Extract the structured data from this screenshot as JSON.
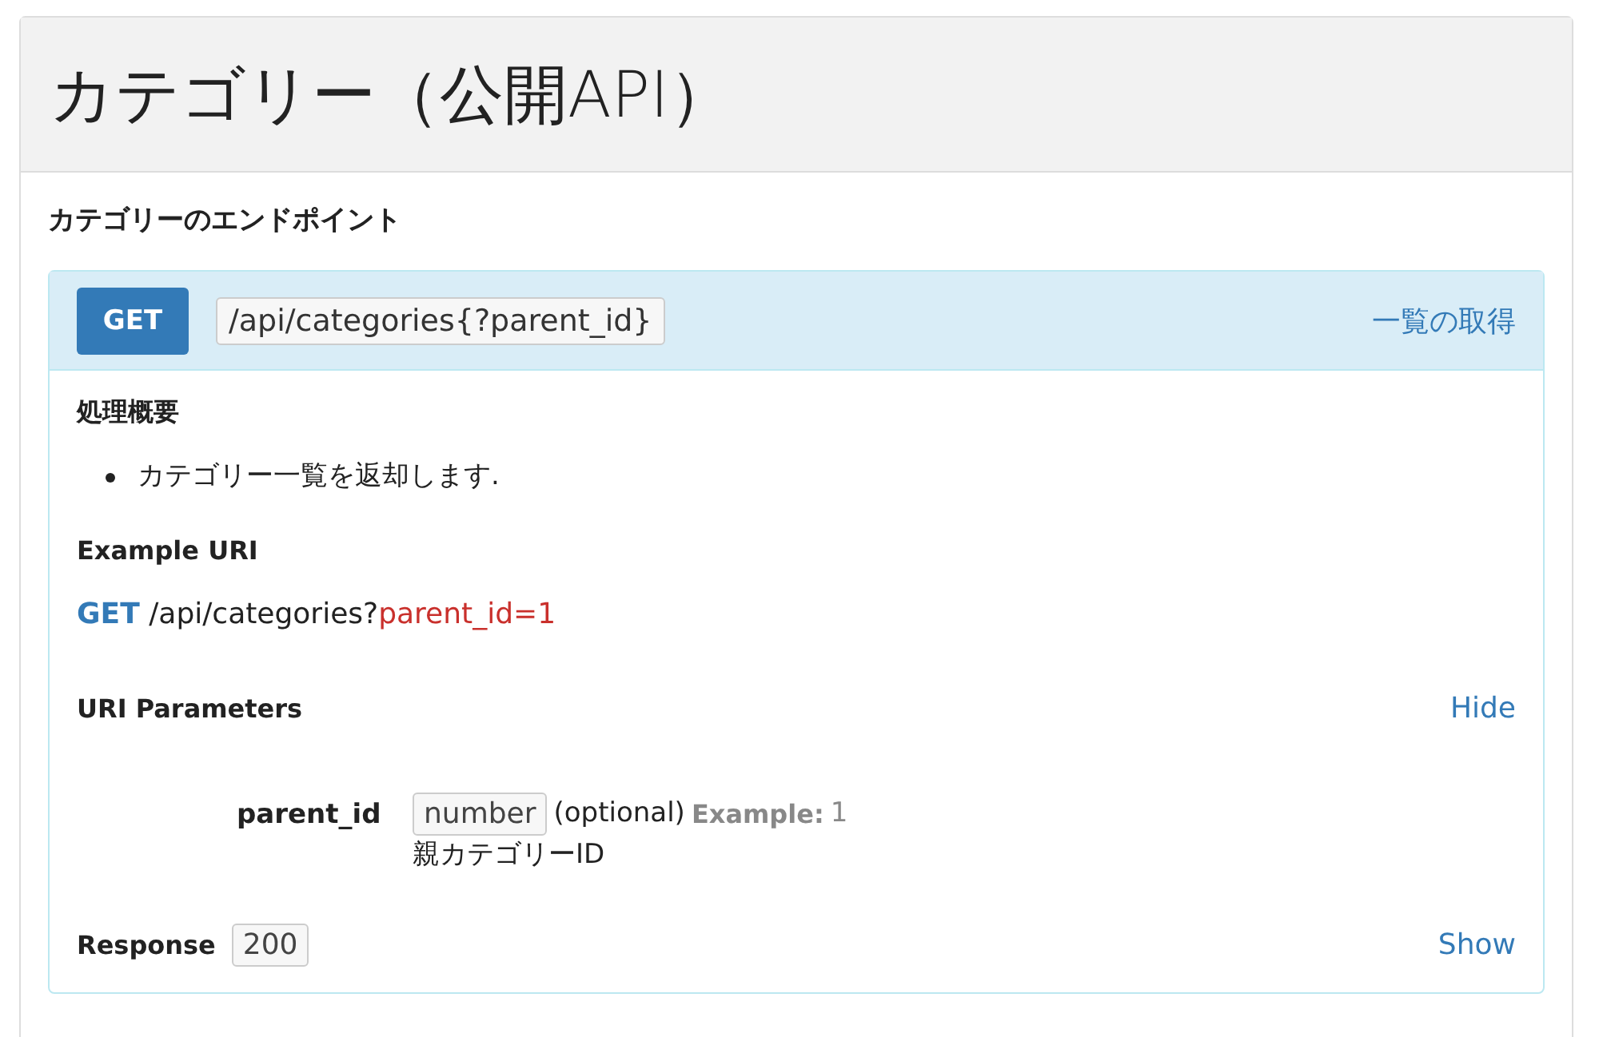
{
  "page_title": "カテゴリー（公開API）",
  "section_title": "カテゴリーのエンドポイント",
  "endpoint": {
    "method": "GET",
    "path": "/api/categories{?parent_id}",
    "action": "一覧の取得",
    "summary_heading": "処理概要",
    "summary_items": [
      "カテゴリー一覧を返却します."
    ],
    "example_heading": "Example URI",
    "example": {
      "method": "GET",
      "path": "/api/categories?",
      "query": "parent_id=1"
    },
    "params_heading": "URI Parameters",
    "params_toggle": "Hide",
    "params": [
      {
        "name": "parent_id",
        "type": "number",
        "optional": "(optional)",
        "example_label": "Example:",
        "example_value": "1",
        "description": "親カテゴリーID"
      }
    ],
    "response_label": "Response",
    "response_code": "200",
    "response_toggle": "Show"
  }
}
